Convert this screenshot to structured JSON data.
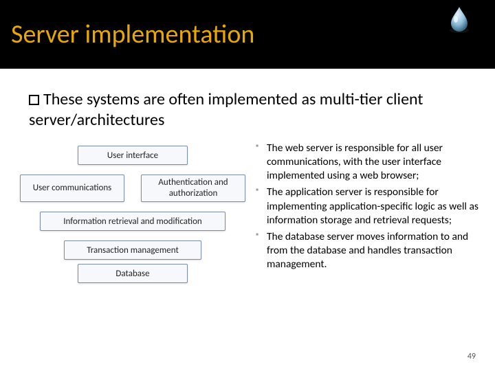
{
  "title": "Server implementation",
  "intro": "These systems are often implemented as multi-tier client server/architectures",
  "diagram": {
    "user_interface": "User interface",
    "user_comm": "User communications",
    "auth": "Authentication and authorization",
    "info_retrieval": "Information retrieval and modification",
    "txn_mgmt": "Transaction management",
    "database": "Database"
  },
  "bullets": [
    "The web server is responsible for all user communications, with the user interface implemented using a web browser;",
    "The application server is responsible for implementing application-specific logic as well as information storage and retrieval requests;",
    "The database server moves information to and from the database and handles transaction management."
  ],
  "page_number": "49"
}
